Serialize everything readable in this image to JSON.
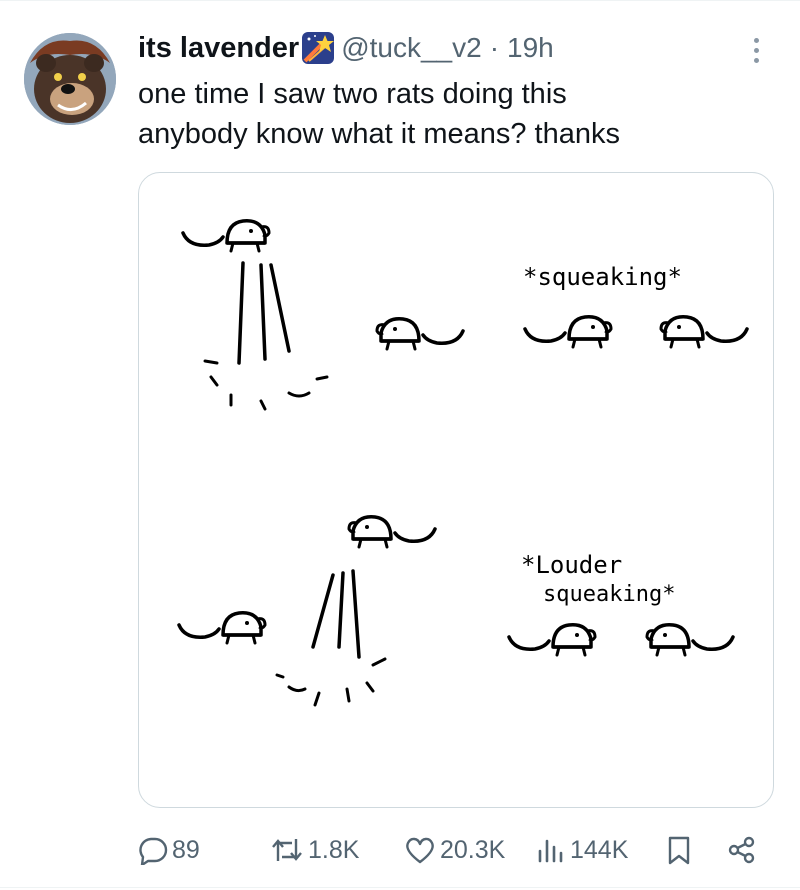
{
  "tweet": {
    "display_name": "its lavender",
    "handle": "@tuck__v2",
    "separator": "·",
    "time": "19h",
    "text_lines": [
      "one time I saw two rats doing this",
      "anybody know what it means? thanks"
    ]
  },
  "icons": {
    "avatar": "bear-avatar",
    "badge": "shooting-star-emoji",
    "more": "more-dots-icon"
  },
  "media": {
    "caption_top": "*squeaking*",
    "caption_bottom_line1": "*Louder",
    "caption_bottom_line2": "squeaking*"
  },
  "actions": {
    "replies": "89",
    "reposts": "1.8K",
    "likes": "20.3K",
    "views": "144K"
  },
  "colors": {
    "text": "#0f1419",
    "secondary": "#536471",
    "border": "#cfd9de"
  }
}
